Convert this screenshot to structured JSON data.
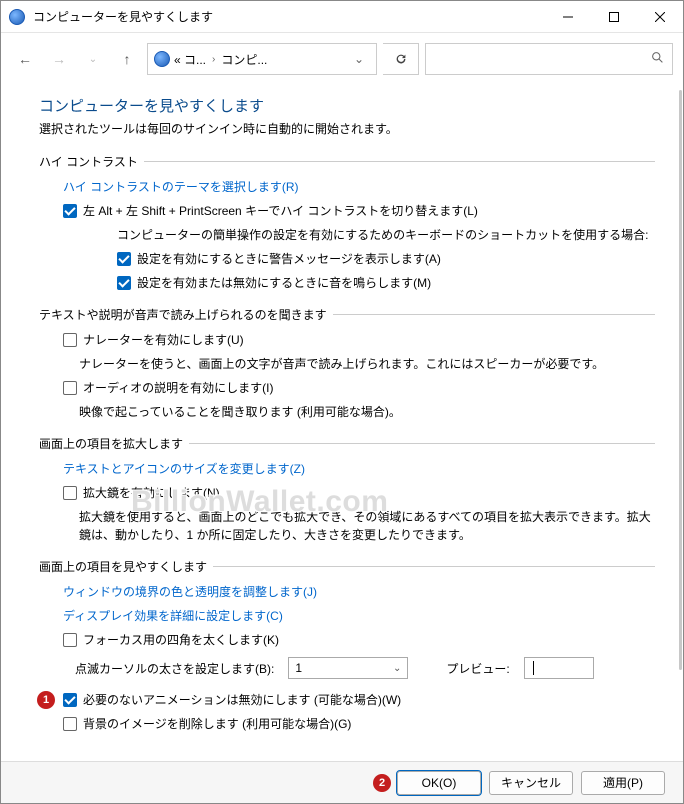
{
  "window": {
    "title": "コンピューターを見やすくします"
  },
  "nav": {
    "addr_seg1": "« コ...",
    "addr_seg2": "コンピ...",
    "search_placeholder": ""
  },
  "page": {
    "heading": "コンピューターを見やすくします",
    "subtitle": "選択されたツールは毎回のサインイン時に自動的に開始されます。"
  },
  "sections": {
    "high_contrast": {
      "title": "ハイ コントラスト",
      "link_theme": "ハイ コントラストのテーマを選択します(R)",
      "toggle_label": "左 Alt + 左 Shift + PrintScreen キーでハイ コントラストを切り替えます(L)",
      "shortcut_note": "コンピューターの簡単操作の設定を有効にするためのキーボードのショートカットを使用する場合:",
      "warn_label": "設定を有効にするときに警告メッセージを表示します(A)",
      "sound_label": "設定を有効または無効にするときに音を鳴らします(M)"
    },
    "narrator": {
      "title": "テキストや説明が音声で読み上げられるのを聞きます",
      "narrator_label": "ナレーターを有効にします(U)",
      "narrator_desc": "ナレーターを使うと、画面上の文字が音声で読み上げられます。これにはスピーカーが必要です。",
      "audio_label": "オーディオの説明を有効にします(I)",
      "audio_desc": "映像で起こっていることを聞き取ります (利用可能な場合)。"
    },
    "enlarge": {
      "title": "画面上の項目を拡大します",
      "size_link": "テキストとアイコンのサイズを変更します(Z)",
      "magnifier_label": "拡大鏡を有効にします(N)",
      "magnifier_desc": "拡大鏡を使用すると、画面上のどこでも拡大でき、その領域にあるすべての項目を拡大表示できます。拡大鏡は、動かしたり、1 か所に固定したり、大きさを変更したりできます。"
    },
    "visibility": {
      "title": "画面上の項目を見やすくします",
      "border_link": "ウィンドウの境界の色と透明度を調整します(J)",
      "display_link": "ディスプレイ効果を詳細に設定します(C)",
      "focus_label": "フォーカス用の四角を太くします(K)",
      "cursor_label": "点滅カーソルの太さを設定します(B):",
      "cursor_value": "1",
      "preview_label": "プレビュー:",
      "anim_label": "必要のないアニメーションは無効にします (可能な場合)(W)",
      "bg_label": "背景のイメージを削除します (利用可能な場合)(G)"
    }
  },
  "footer": {
    "ok": "OK(O)",
    "cancel": "キャンセル",
    "apply": "適用(P)"
  },
  "annotations": {
    "a1": "1",
    "a2": "2"
  },
  "watermark": "BillionWallet.com"
}
